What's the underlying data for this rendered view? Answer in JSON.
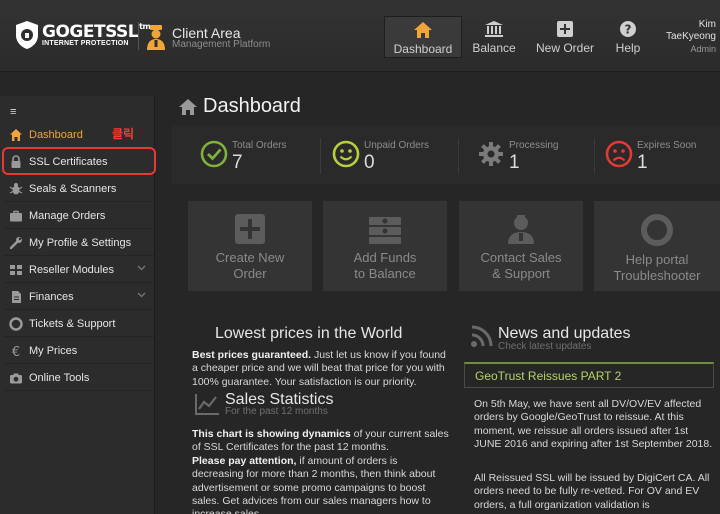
{
  "brand": {
    "name": "GOGETSSL",
    "tm": "tm",
    "tagline": "INTERNET PROTECTION"
  },
  "header": {
    "title": "Client Area",
    "subtitle": "Management Platform"
  },
  "nav": [
    {
      "label": "Dashboard",
      "icon": "home-icon",
      "active": true
    },
    {
      "label": "Balance",
      "icon": "bank-icon"
    },
    {
      "label": "New Order",
      "icon": "plus-icon"
    },
    {
      "label": "Help",
      "icon": "question-icon"
    }
  ],
  "user": {
    "first": "Kim",
    "last": "TaeKyeong",
    "role": "Admin"
  },
  "sidebar": {
    "menu_icon": "≡",
    "click_badge": "클릭",
    "items": [
      {
        "label": "Dashboard",
        "icon": "home-icon",
        "active": true
      },
      {
        "label": "SSL Certificates",
        "icon": "lock-icon"
      },
      {
        "label": "Seals & Scanners",
        "icon": "bug-icon"
      },
      {
        "label": "Manage Orders",
        "icon": "briefcase-icon"
      },
      {
        "label": "My Profile & Settings",
        "icon": "wrench-icon"
      },
      {
        "label": "Reseller Modules",
        "icon": "th-icon",
        "chevron": true
      },
      {
        "label": "Finances",
        "icon": "file-icon",
        "chevron": true
      },
      {
        "label": "Tickets & Support",
        "icon": "lifebuoy-icon"
      },
      {
        "label": "My Prices",
        "icon": "euro-icon"
      },
      {
        "label": "Online Tools",
        "icon": "camera-icon"
      }
    ]
  },
  "page": {
    "title": "Dashboard"
  },
  "stats": [
    {
      "label": "Total Orders",
      "value": "7",
      "icon": "check-circle-icon",
      "color": "#7fb23a"
    },
    {
      "label": "Unpaid Orders",
      "value": "0",
      "icon": "smile-icon",
      "color": "#b7d03c"
    },
    {
      "label": "Processing",
      "value": "1",
      "icon": "gear-icon",
      "color": "#7a7a7a"
    },
    {
      "label": "Expires Soon",
      "value": "1",
      "icon": "frown-icon",
      "color": "#e53935"
    }
  ],
  "tiles": [
    {
      "line1": "Create New",
      "line2": "Order",
      "icon": "plus-square-icon"
    },
    {
      "line1": "Add Funds",
      "line2": "to Balance",
      "icon": "money-icon"
    },
    {
      "line1": "Contact Sales",
      "line2": "& Support",
      "icon": "support-agent-icon"
    },
    {
      "line1": "Help portal",
      "line2": "Troubleshooter",
      "icon": "lifebuoy-icon"
    }
  ],
  "lowest": {
    "title": "Lowest prices in the World",
    "bold": "Best prices guaranteed.",
    "text": " Just let us know if you found a cheaper price and we will beat that price for you with 100% guarantee. Your satisfaction is our priority."
  },
  "sales": {
    "title": "Sales Statistics",
    "subtitle": "For the past 12 months",
    "bold1": "This chart is showing dynamics",
    "text1": " of your current sales of SSL Certificates for the past 12 months.",
    "bold2": "Please pay attention,",
    "text2": " if amount of orders is decreasing for more than 2 months, then think about advertisement or some promo campaigns to boost sales. Get advices from our sales managers how to increase sales."
  },
  "news": {
    "title": "News and updates",
    "subtitle": "Check latest updates",
    "headline": "GeoTrust Reissues PART 2",
    "p1": "On 5th May, we have sent all DV/OV/EV affected orders by Google/GeoTrust to reissue. At this moment, we reissue all orders issued after 1st JUNE 2016 and expiring after 1st September 2018.",
    "p2": "All Reissued SSL will be issued by DigiCert CA. All orders need to be fully re-vetted. For OV and EV orders, a full organization validation is"
  }
}
